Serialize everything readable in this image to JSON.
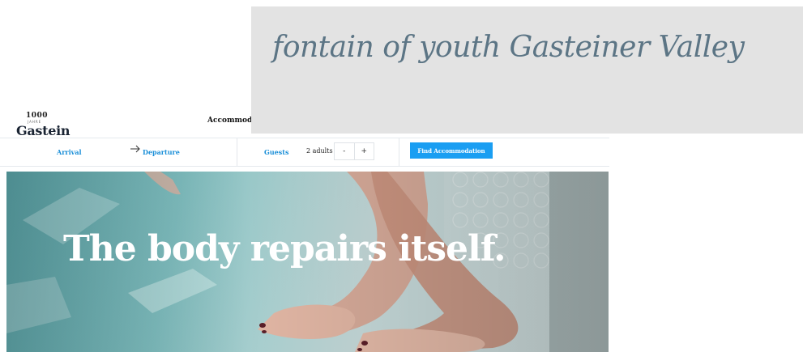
{
  "header": {
    "logo_years": "1000",
    "logo_subtitle": "JAHRE",
    "logo_name": "Gastein",
    "nav_accommodation": "Accommoda"
  },
  "booking": {
    "arrival_label": "Arrival",
    "departure_label": "Departure",
    "guests_label": "Guests",
    "adults_value": "2 adults",
    "decrement_label": "-",
    "increment_label": "+",
    "find_button_label": "Find Accommodation"
  },
  "hero": {
    "title": "The body repairs itself."
  },
  "zoom_overlay": {
    "text": "fontain of youth Gasteiner Valley"
  },
  "colors": {
    "accent_blue": "#1a9ef2",
    "link_blue": "#1b8fd8",
    "logo_dark": "#1a2433",
    "zoom_text": "#5c7585"
  },
  "icons": {
    "arrow": "arrow-right-icon"
  }
}
